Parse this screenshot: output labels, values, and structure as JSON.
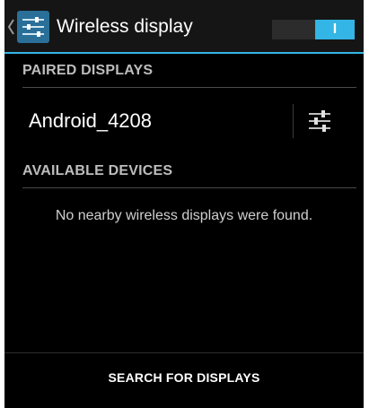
{
  "action_bar": {
    "title": "Wireless display",
    "up_icon": "chevron-left-icon",
    "app_icon": "settings-sliders-icon",
    "toggle": {
      "state": "on",
      "label": "I"
    }
  },
  "sections": {
    "paired": {
      "header": "PAIRED DISPLAYS",
      "devices": [
        {
          "name": "Android_4208",
          "settings_icon": "sliders-icon"
        }
      ]
    },
    "available": {
      "header": "AVAILABLE DEVICES",
      "empty_message": "No nearby wireless displays were found."
    }
  },
  "bottom_bar": {
    "search_label": "SEARCH FOR DISPLAYS"
  },
  "colors": {
    "accent": "#33b5e5",
    "background": "#000000",
    "action_bar": "#151515"
  }
}
